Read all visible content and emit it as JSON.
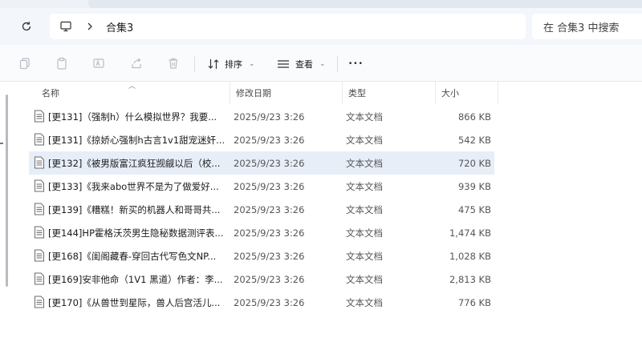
{
  "address": {
    "breadcrumb": "合集3",
    "search_placeholder": "在 合集3 中搜索"
  },
  "toolbar": {
    "sort_label": "排序",
    "view_label": "查看",
    "more_label": "•••"
  },
  "columns": {
    "name": "名称",
    "date": "修改日期",
    "type": "类型",
    "size": "大小"
  },
  "files": [
    {
      "name": "[更131]（强制h）什么模拟世界？我要...",
      "date": "2025/9/23 3:26",
      "type": "文本文档",
      "size": "866 KB"
    },
    {
      "name": "[更131]《掠娇心强制h古言1v1甜宠迷奸...",
      "date": "2025/9/23 3:26",
      "type": "文本文档",
      "size": "542 KB"
    },
    {
      "name": "[更132]《被男版富江疯狂觊觎以后（校...",
      "date": "2025/9/23 3:26",
      "type": "文本文档",
      "size": "720 KB"
    },
    {
      "name": "[更133]《我来abo世界不是为了做爱好...",
      "date": "2025/9/23 3:26",
      "type": "文本文档",
      "size": "939 KB"
    },
    {
      "name": "[更139]《糟糕！新买的机器人和哥哥共...",
      "date": "2025/9/23 3:26",
      "type": "文本文档",
      "size": "475 KB"
    },
    {
      "name": "[更144]HP霍格沃茨男生隐秘数据测评表...",
      "date": "2025/9/23 3:26",
      "type": "文本文档",
      "size": "1,474 KB"
    },
    {
      "name": "[更168]《闺阁藏春-穿回古代写色文NP...",
      "date": "2025/9/23 3:26",
      "type": "文本文档",
      "size": "1,028 KB"
    },
    {
      "name": "[更169]安非他命（1V1 黑道）作者：李...",
      "date": "2025/9/23 3:26",
      "type": "文本文档",
      "size": "2,813 KB"
    },
    {
      "name": "[更170]《从兽世到星际，兽人后宫活儿...",
      "date": "2025/9/23 3:26",
      "type": "文本文档",
      "size": "776 KB"
    }
  ],
  "selected_index": 2
}
